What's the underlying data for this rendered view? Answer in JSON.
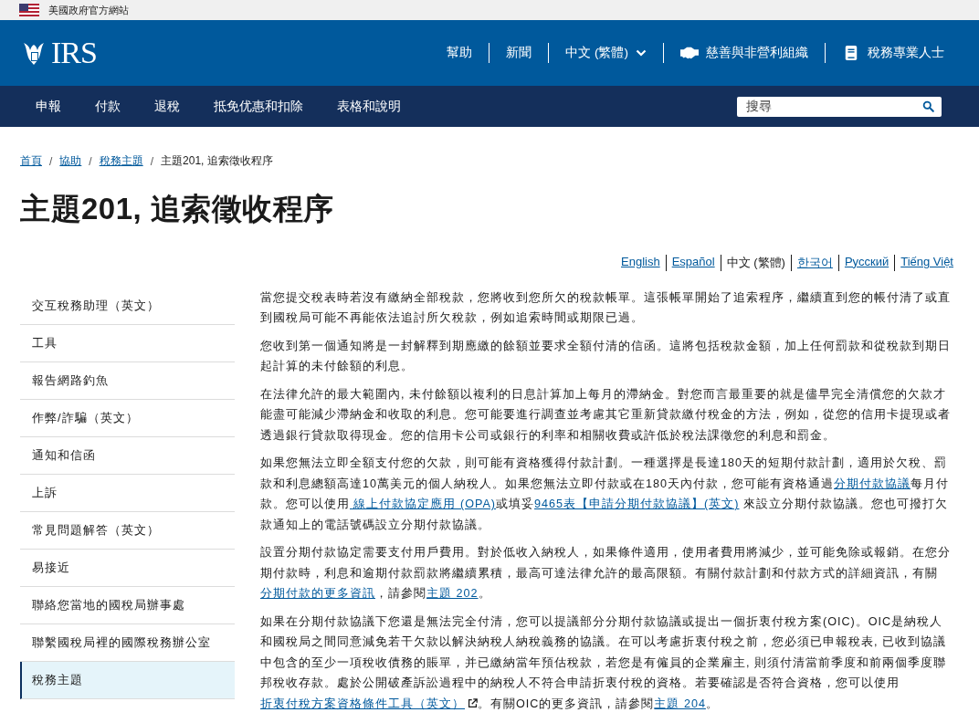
{
  "gov_banner": {
    "text": "美國政府官方網站"
  },
  "header": {
    "logo_text": "IRS",
    "links": [
      {
        "label": "幫助",
        "kind": "plain"
      },
      {
        "label": "新聞",
        "kind": "plain"
      },
      {
        "label": "中文 (繁體)",
        "kind": "dropdown"
      },
      {
        "label": "慈善與非營利組織",
        "kind": "handshake"
      },
      {
        "label": "稅務專業人士",
        "kind": "book"
      }
    ]
  },
  "nav": {
    "items": [
      "申報",
      "付款",
      "退稅",
      "抵免优惠和扣除",
      "表格和說明"
    ],
    "search": {
      "placeholder": "搜尋"
    }
  },
  "breadcrumb": {
    "separator": "/",
    "items": [
      {
        "label": "首頁",
        "current": false
      },
      {
        "label": "協助",
        "current": false
      },
      {
        "label": "稅務主題",
        "current": false
      },
      {
        "label": "主題201, 追索徵收程序",
        "current": true
      }
    ]
  },
  "title": "主題201, 追索徵收程序",
  "languages": [
    {
      "label": "English",
      "selected": false
    },
    {
      "label": "Español",
      "selected": false
    },
    {
      "label": "中文 (繁體)",
      "selected": true
    },
    {
      "label": "한국어",
      "selected": false
    },
    {
      "label": "Русский",
      "selected": false
    },
    {
      "label": "Tiếng Việt",
      "selected": false
    }
  ],
  "sidebar": {
    "items": [
      {
        "label": "交互稅務助理（英文）",
        "selected": false
      },
      {
        "label": "工具",
        "selected": false
      },
      {
        "label": "報告網路釣魚",
        "selected": false
      },
      {
        "label": "作弊/詐騙（英文）",
        "selected": false
      },
      {
        "label": "通知和信函",
        "selected": false
      },
      {
        "label": "上訴",
        "selected": false
      },
      {
        "label": "常見問題解答（英文）",
        "selected": false
      },
      {
        "label": "易接近",
        "selected": false
      },
      {
        "label": "聯絡您當地的國稅局辦事處",
        "selected": false
      },
      {
        "label": "聯繫國稅局裡的國際稅務辦公室",
        "selected": false
      },
      {
        "label": "稅務主題",
        "selected": true
      }
    ]
  },
  "paragraphs": [
    [
      {
        "kind": "text",
        "text": "當您提交稅表時若沒有繳納全部稅款，您將收到您所欠的稅款帳單。這張帳單開始了追索程序，繼續直到您的帳付清了或直到國稅局可能不再能依法追討所欠稅款，例如追索時間或期限已過。"
      }
    ],
    [
      {
        "kind": "text",
        "text": "您收到第一個通知將是一封解釋到期應繳的餘額並要求全額付清的信函。這將包括稅款金額，加上任何罰款和從稅款到期日起計算的未付餘額的利息。"
      }
    ],
    [
      {
        "kind": "text",
        "text": "在法律允許的最大範圍內, 未付餘額以複利的日息計算加上每月的滯納金。對您而言最重要的就是儘早完全清償您的欠款才能盡可能減少滯納金和收取的利息。您可能要進行調查並考慮其它重新貸款繳付稅金的方法，例如，從您的信用卡提現或者透過銀行貸款取得現金。您的信用卡公司或銀行的利率和相關收費或許低於稅法課徵您的利息和罰金。"
      }
    ],
    [
      {
        "kind": "text",
        "text": "如果您無法立即全額支付您的欠款，則可能有資格獲得付款計劃。一種選擇是長達180天的短期付款計劃，適用於欠稅、罰款和利息總額高達10萬美元的個人納稅人。如果您無法立即付款或在180天內付款，您可能有資格通過"
      },
      {
        "kind": "link",
        "text": "分期付款協議"
      },
      {
        "kind": "text",
        "text": "每月付款。您可以使用"
      },
      {
        "kind": "link",
        "text": " 線上付款協定應用 (OPA)"
      },
      {
        "kind": "text",
        "text": "或填妥"
      },
      {
        "kind": "link",
        "text": "9465表【申請分期付款協議】(英文)"
      },
      {
        "kind": "text",
        "text": " 來設立分期付款協議。您也可撥打欠款通知上的電話號碼設立分期付款協議。"
      }
    ],
    [
      {
        "kind": "text",
        "text": "設置分期付款協定需要支付用戶費用。對於低收入納稅人，如果條件適用，使用者費用將減少，並可能免除或報銷。在您分期付款時，利息和逾期付款罰款將繼續累積，最高可達法律允許的最高限額。有關付款計劃和付款方式的詳細資訊，有關"
      },
      {
        "kind": "link",
        "text": "分期付款的更多資訊"
      },
      {
        "kind": "text",
        "text": "，請參閱"
      },
      {
        "kind": "link",
        "text": "主題 202"
      },
      {
        "kind": "text",
        "text": "。"
      }
    ],
    [
      {
        "kind": "text",
        "text": "如果在分期付款協議下您還是無法完全付清，您可以提議部分分期付款協議或提出一個折衷付稅方案(OIC)。OIC是納稅人和國稅局之間同意減免若干欠款以解決納稅人納稅義務的協議。在可以考慮折衷付稅之前，您必須已申報稅表, 已收到協議中包含的至少一項稅收債務的賬單，并已繳納當年預估稅款，若您是有僱員的企業雇主, 則須付清當前季度和前兩個季度聯邦稅收存款。處於公開破產訴訟過程中的納稅人不符合申請折衷付稅的資格。若要確認是否符合資格，您可以使用"
      },
      {
        "kind": "external-link",
        "text": "折衷付稅方案資格條件工具（英文）"
      },
      {
        "kind": "text",
        "text": "。有關OIC的更多資訊，請參閱"
      },
      {
        "kind": "link",
        "text": "主題 204"
      },
      {
        "kind": "text",
        "text": "。"
      }
    ]
  ]
}
